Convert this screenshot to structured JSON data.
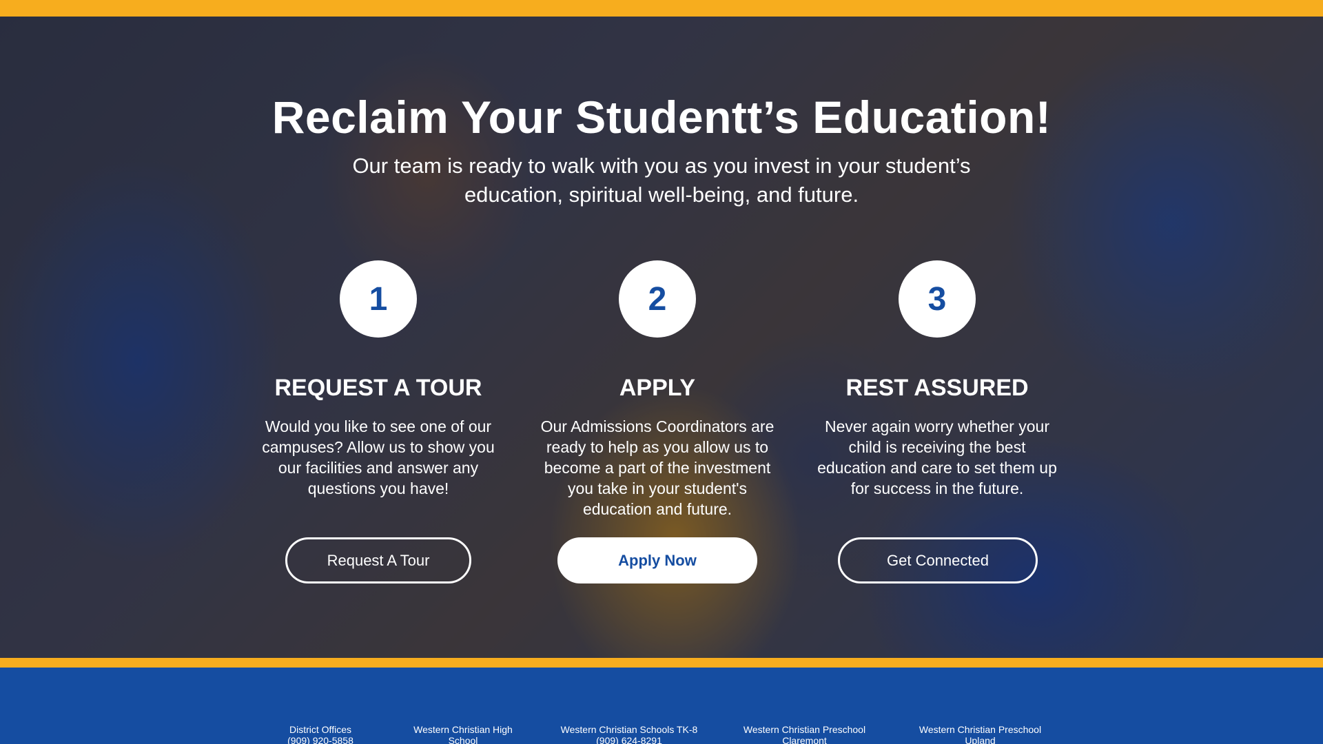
{
  "colors": {
    "gold": "#f7ad1e",
    "brand_blue": "#154da1",
    "white": "#ffffff"
  },
  "hero": {
    "title": "Reclaim Your Studentt’s Education!",
    "subtitle": "Our team is ready to walk with you as you invest in your student’s education, spiritual well-being, and future."
  },
  "steps": [
    {
      "number": "1",
      "heading": "REQUEST A TOUR",
      "text": "Would you like to see one of our campuses? Allow us to show you our facilities and answer any questions you have!",
      "button_label": "Request A Tour"
    },
    {
      "number": "2",
      "heading": "APPLY",
      "text": "Our Admissions Coordinators are ready to help as you allow us to become a part of the investment you take in your student's education and future.",
      "button_label": "Apply Now"
    },
    {
      "number": "3",
      "heading": "REST ASSURED",
      "text": "Never again worry whether your child is receiving the best education and care to set them up for success in the future.",
      "button_label": "Get Connected"
    }
  ],
  "footer": {
    "locations": [
      {
        "name": "District Offices",
        "detail": "(909) 920-5858"
      },
      {
        "name": "Western Christian High School",
        "detail": ""
      },
      {
        "name": "Western Christian Schools TK-8",
        "detail": "(909) 624-8291"
      },
      {
        "name": "Western Christian Preschool Claremont",
        "detail": ""
      },
      {
        "name": "Western Christian Preschool Upland",
        "detail": ""
      }
    ]
  }
}
